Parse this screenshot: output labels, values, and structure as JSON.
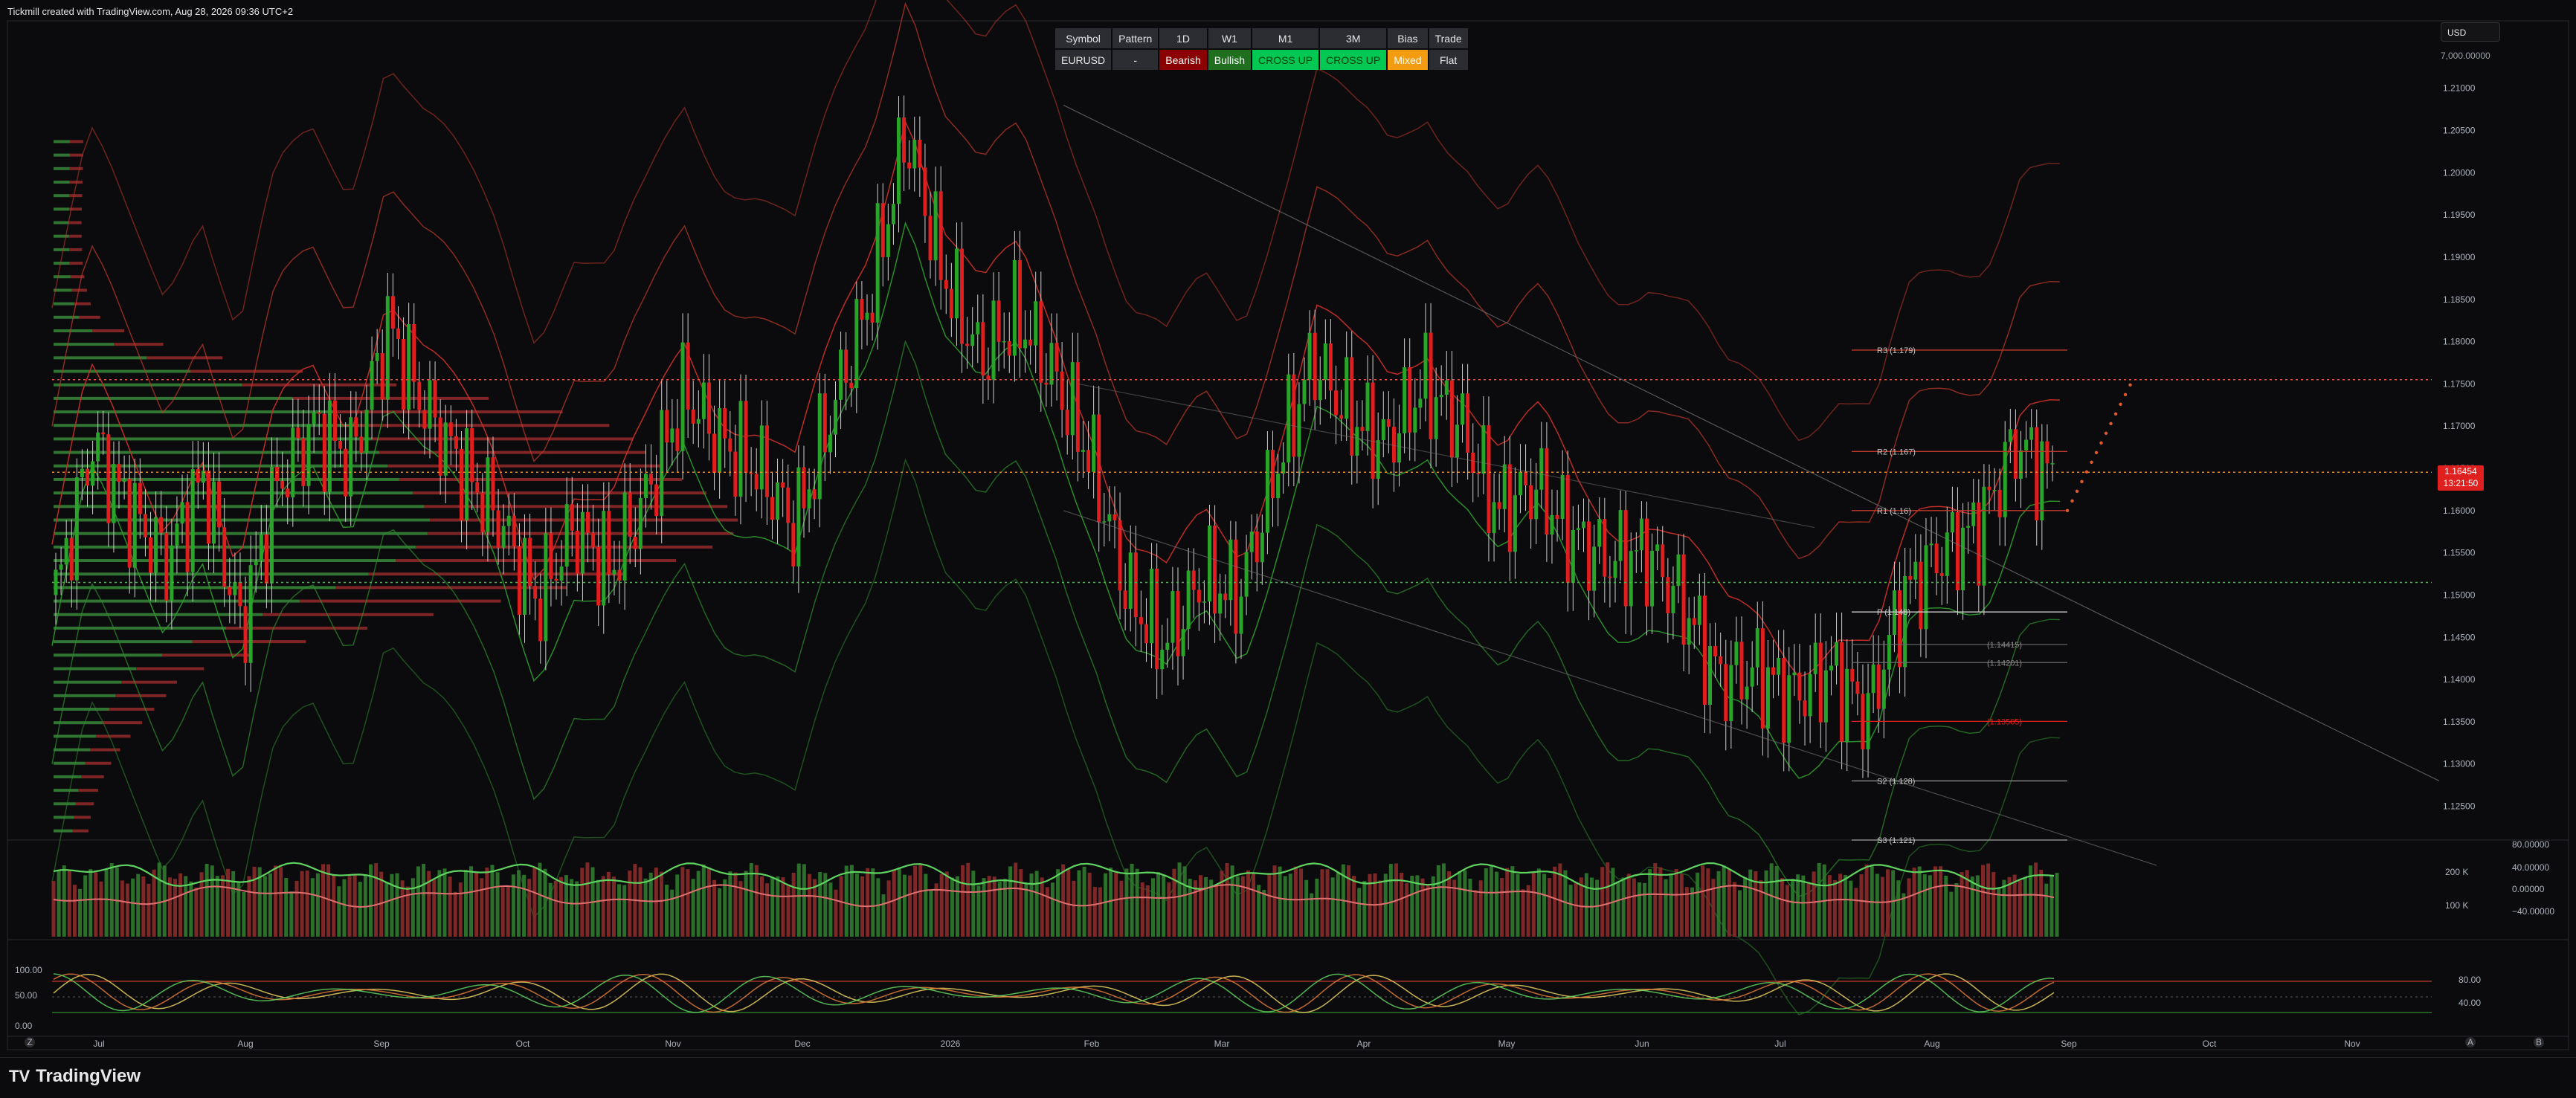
{
  "header": {
    "text": "Tickmill created with TradingView.com, Aug 28, 2026 09:36 UTC+2"
  },
  "currency": {
    "label": "USD",
    "value": "7,000.00000"
  },
  "bias_table": {
    "headers": [
      "Symbol",
      "Pattern",
      "1D",
      "W1",
      "M1",
      "3M",
      "Bias",
      "Trade"
    ],
    "values": [
      "EURUSD",
      "-",
      "Bearish",
      "Bullish",
      "CROSS UP",
      "CROSS UP",
      "Mixed",
      "Flat"
    ],
    "value_colors": [
      "#2b2d33",
      "#2b2d33",
      "#8b0000",
      "#1f6f1f",
      "#00c853",
      "#00c853",
      "#f39c12",
      "#2b2d33"
    ],
    "value_text_colors": [
      "#e6e6e6",
      "#e6e6e6",
      "#ffffff",
      "#ffffff",
      "#0b3d0b",
      "#0b3d0b",
      "#ffffff",
      "#e6e6e6"
    ]
  },
  "price_box": {
    "price": "1.16454",
    "countdown": "13:21:50"
  },
  "pivots": [
    {
      "label": "R3 (1.179)",
      "y": 1.179
    },
    {
      "label": "R2 (1.167)",
      "y": 1.167
    },
    {
      "label": "R1 (1.16)",
      "y": 1.16
    },
    {
      "label": "P (1.148)",
      "y": 1.148
    },
    {
      "label": "S2 (1.128)",
      "y": 1.128
    },
    {
      "label": "S3 (1.121)",
      "y": 1.121
    }
  ],
  "levels": [
    {
      "label": "(1.14415)",
      "y": 1.14415
    },
    {
      "label": "(1.14201)",
      "y": 1.14201
    },
    {
      "label": "(1.13505)",
      "y": 1.13505
    }
  ],
  "chart_data": {
    "type": "candlestick",
    "symbol": "EURUSD",
    "ylim": [
      1.121,
      1.212
    ],
    "y_ticks": [
      "1.21000",
      "1.20500",
      "1.20000",
      "1.19500",
      "1.19000",
      "1.18500",
      "1.18000",
      "1.17500",
      "1.17000",
      "1.16500",
      "1.16000",
      "1.15500",
      "1.15000",
      "1.14500",
      "1.14000",
      "1.13500",
      "1.13000",
      "1.12500"
    ],
    "x_ticks": [
      "Jul",
      "Aug",
      "Sep",
      "Oct",
      "Nov",
      "Dec",
      "2026",
      "Feb",
      "Mar",
      "Apr",
      "May",
      "Jun",
      "Jul",
      "Aug",
      "Sep",
      "Oct",
      "Nov"
    ],
    "current_price": 1.16454,
    "price_path": [
      1.15,
      1.168,
      1.16,
      1.154,
      1.164,
      1.146,
      1.163,
      1.17,
      1.166,
      1.182,
      1.172,
      1.165,
      1.159,
      1.149,
      1.158,
      1.153,
      1.162,
      1.174,
      1.168,
      1.165,
      1.158,
      1.172,
      1.185,
      1.205,
      1.188,
      1.178,
      1.183,
      1.176,
      1.166,
      1.15,
      1.144,
      1.152,
      1.15,
      1.165,
      1.178,
      1.171,
      1.168,
      1.175,
      1.17,
      1.16,
      1.163,
      1.157,
      1.154,
      1.155,
      1.149,
      1.14,
      1.141,
      1.138,
      1.141,
      1.136,
      1.15,
      1.155,
      1.158,
      1.168,
      1.164
    ],
    "volume_panel": {
      "ticks": [
        "200 K",
        "100 K"
      ],
      "osc_ticks": [
        "80.00000",
        "40.00000",
        "0.00000",
        "−40.00000"
      ]
    },
    "stoch_panel": {
      "left_ticks": [
        "100.00",
        "50.00",
        "0.00"
      ],
      "right_ticks": [
        "80.00",
        "40.00"
      ]
    }
  },
  "footer": {
    "brand": "TradingView",
    "left_badge": "Z",
    "right_badges": [
      "A",
      "B"
    ]
  }
}
